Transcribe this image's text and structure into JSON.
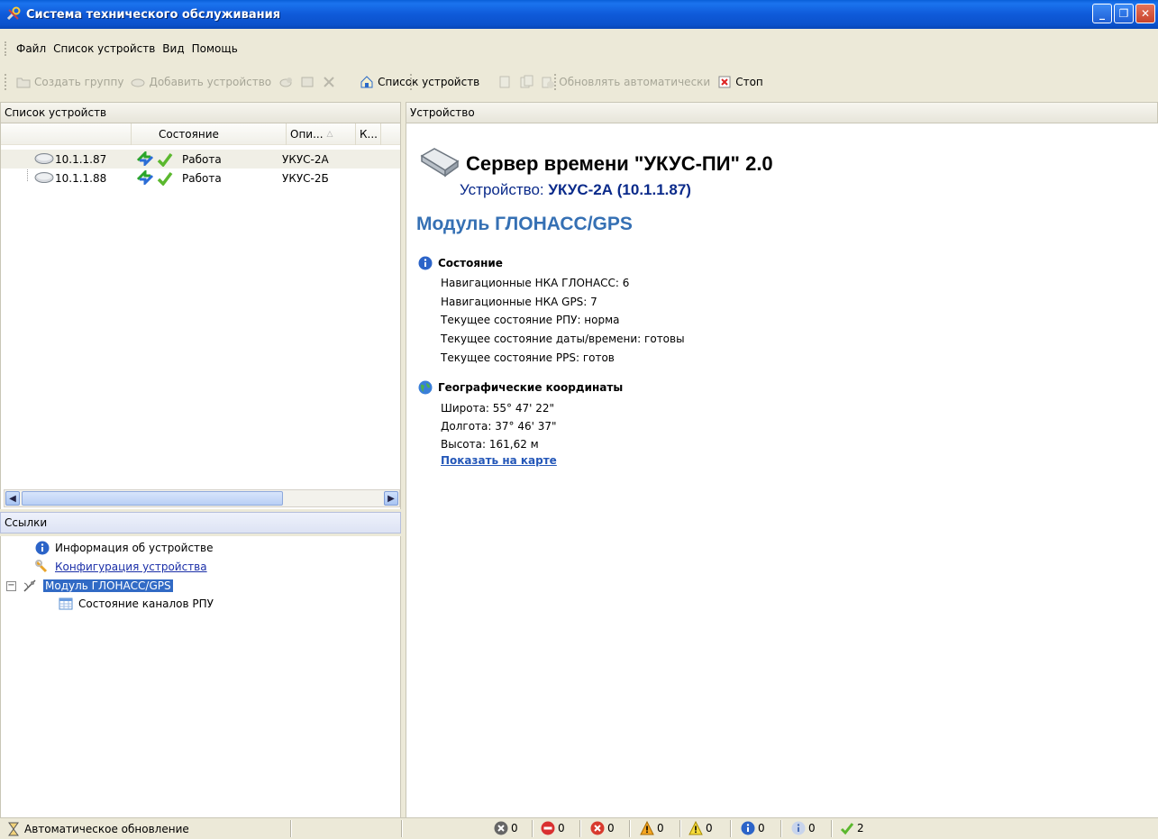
{
  "window": {
    "title": "Система технического обслуживания",
    "controls": [
      "minimize",
      "maximize",
      "close"
    ]
  },
  "menu": [
    "Файл",
    "Список устройств",
    "Вид",
    "Помощь"
  ],
  "toolbar": {
    "create_group": "Создать группу",
    "add_device": "Добавить устройство",
    "device_list": "Список устройств",
    "auto_refresh": "Обновлять автоматически",
    "stop": "Стоп"
  },
  "device_list": {
    "header": "Список устройств",
    "columns": [
      "Состояние",
      "Опи...",
      "К..."
    ],
    "rows": [
      {
        "ip": "10.1.1.87",
        "status": "Работа",
        "desc": "УКУС-2А"
      },
      {
        "ip": "10.1.1.88",
        "status": "Работа",
        "desc": "УКУС-2Б"
      }
    ]
  },
  "links": {
    "header": "Ссылки",
    "items": [
      {
        "label": "Информация об устройстве"
      },
      {
        "label": "Конфигурация устройства"
      },
      {
        "label": "Модуль ГЛОНАСС/GPS"
      },
      {
        "label": "Состояние каналов РПУ"
      }
    ]
  },
  "device_panel": {
    "header": "Устройство",
    "server_title": "Сервер времени \"УКУС-ПИ\" 2.0",
    "device_prefix": "Устройство:",
    "device_name": "УКУС-2А (10.1.1.87)",
    "module_title": "Модуль ГЛОНАСС/GPS",
    "state_title": "Состояние",
    "state_lines": [
      "Навигационные НКА ГЛОНАСС: 6",
      "Навигационные НКА GPS: 7",
      "Текущее состояние РПУ: норма",
      "Текущее состояние даты/времени: готовы",
      "Текущее состояние PPS: готов"
    ],
    "geo_title": "Географические координаты",
    "geo_lines": [
      "Широта: 55° 47' 22\"",
      "Долгота: 37° 46' 37\"",
      "Высота: 161,62 м"
    ],
    "map_link": "Показать на карте"
  },
  "statusbar": {
    "auto_update": "Автоматическое обновление",
    "counts": [
      "0",
      "0",
      "0",
      "0",
      "0",
      "0",
      "0",
      "2"
    ]
  },
  "colors": {
    "title_bar": "#0b52cc",
    "module_title": "#3570b4",
    "link": "#1b2fa8",
    "selection": "#316ac5"
  }
}
